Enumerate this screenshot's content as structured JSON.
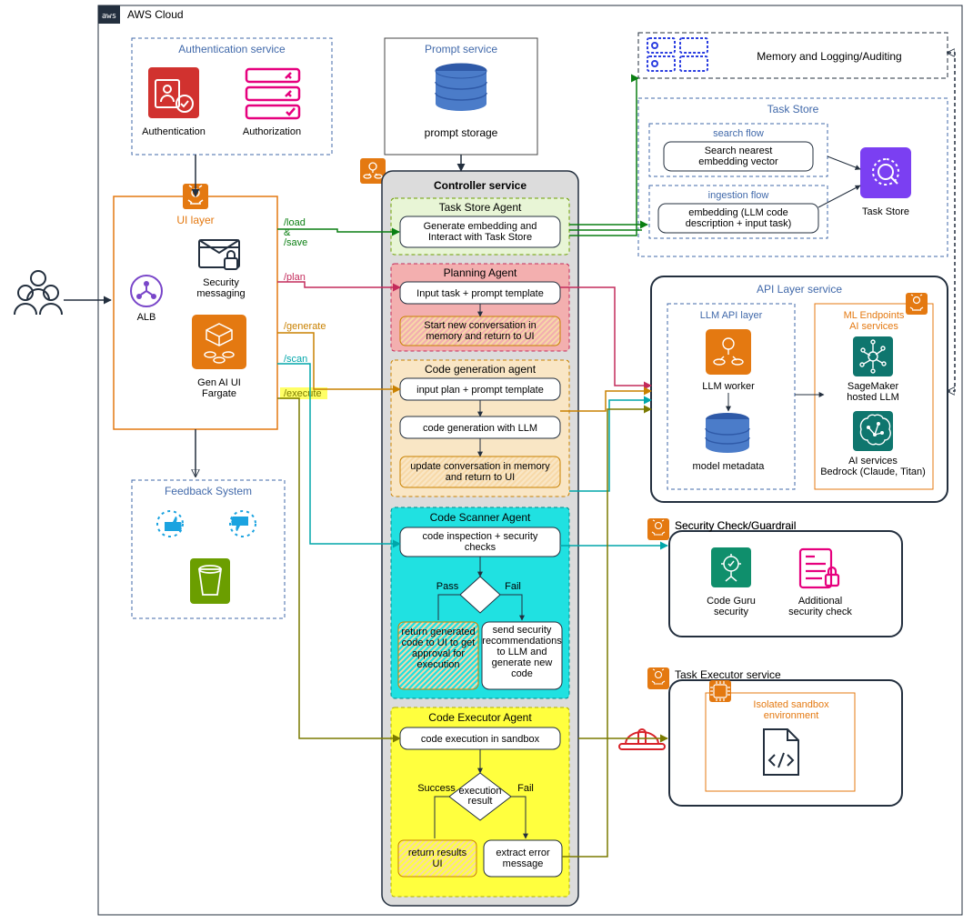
{
  "cloud": {
    "label": "AWS Cloud"
  },
  "users": {
    "label": "Users"
  },
  "auth": {
    "title": "Authentication service",
    "authentication": "Authentication",
    "authorization": "Authorization"
  },
  "prompt": {
    "title": "Prompt service",
    "storage": "prompt storage"
  },
  "memory": {
    "label": "Memory and Logging/Auditing"
  },
  "ui": {
    "title": "UI layer",
    "alb": "ALB",
    "security": "Security messaging",
    "fargate": "Gen AI UI Fargate"
  },
  "feedback": {
    "title": "Feedback System"
  },
  "endpoints": {
    "load": "/load & /save",
    "plan": "/plan",
    "generate": "/generate",
    "scan": "/scan",
    "execute": "/execute"
  },
  "controller": {
    "title": "Controller service",
    "agents": {
      "taskstore": {
        "title": "Task Store Agent",
        "step": "Generate embedding and Interact with Task Store"
      },
      "planning": {
        "title": "Planning Agent",
        "step1": "Input task + prompt template",
        "step2": "Start new conversation in memory and return to UI"
      },
      "codegen": {
        "title": "Code generation agent",
        "step1": "input plan + prompt template",
        "step2": "code generation with LLM",
        "step3": "update conversation in memory and return to UI"
      },
      "scanner": {
        "title": "Code Scanner Agent",
        "step": "code inspection + security checks",
        "pass": "Pass",
        "fail": "Fail",
        "passBox": "return generated code to UI to get approval for execution",
        "failBox": "send security recommendations to LLM and generate new code"
      },
      "executor": {
        "title": "Code Executor Agent",
        "step": "code execution in sandbox",
        "decision": "execution result",
        "success": "Success",
        "fail": "Fail",
        "successBox": "return results UI",
        "failBox": "extract error message"
      }
    }
  },
  "taskstore": {
    "title": "Task Store",
    "search": {
      "title": "search flow",
      "step": "Search nearest embedding vector"
    },
    "ingest": {
      "title": "ingestion flow",
      "step": "embedding (LLM code description + input task)"
    },
    "iconLabel": "Task Store"
  },
  "api": {
    "title": "API Layer service",
    "llmLayer": {
      "title": "LLM API layer",
      "worker": "LLM worker",
      "metadata": "model metadata"
    },
    "ml": {
      "title": "ML Endpoints AI services",
      "sagemaker": "SageMaker hosted LLM",
      "bedrock": "AI services Bedrock (Claude, Titan)"
    }
  },
  "security": {
    "title": "Security Check/Guardrail",
    "codeguru": "Code Guru security",
    "additional": "Additional security check"
  },
  "taskexec": {
    "title": "Task Executor service",
    "sandbox": "Isolated sandbox environment"
  }
}
